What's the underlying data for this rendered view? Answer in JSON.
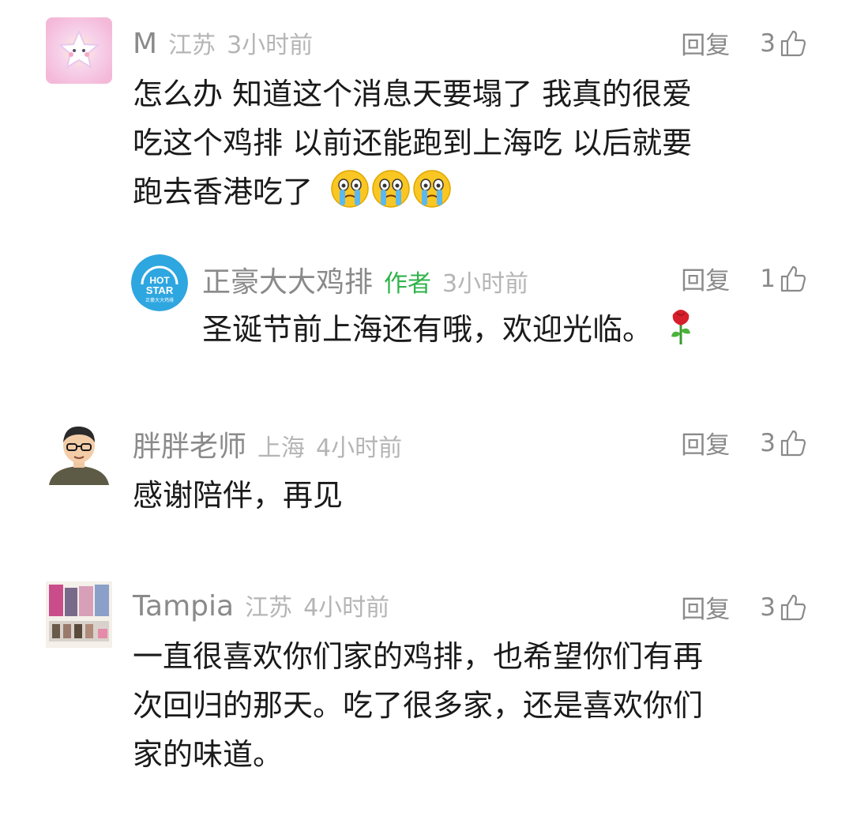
{
  "comments": [
    {
      "name": "M",
      "location": "江苏",
      "time": "3小时前",
      "reply_label": "回复",
      "likes": "3",
      "lines": [
        "怎么办 知道这个消息天要塌了 我真的很爱",
        "吃这个鸡排 以前还能跑到上海吃 以后就要",
        "跑去香港吃了"
      ],
      "emojis": [
        "crying-emoji",
        "crying-emoji",
        "crying-emoji"
      ],
      "reply": {
        "name": "正豪大大鸡排",
        "author_tag": "作者",
        "time": "3小时前",
        "reply_label": "回复",
        "likes": "1",
        "text": "圣诞节前上海还有哦，欢迎光临。",
        "emoji": "rose-emoji",
        "avatar_text": "正豪大大鸡排"
      }
    },
    {
      "name": "胖胖老师",
      "location": "上海",
      "time": "4小时前",
      "reply_label": "回复",
      "likes": "3",
      "lines": [
        "感谢陪伴，再见"
      ]
    },
    {
      "name": "Tampia",
      "location": "江苏",
      "time": "4小时前",
      "reply_label": "回复",
      "likes": "3",
      "lines": [
        "一直很喜欢你们家的鸡排，也希望你们有再",
        "次回归的那天。吃了很多家，还是喜欢你们",
        "家的味道。"
      ]
    }
  ],
  "colors": {
    "name": "#8a8a8a",
    "meta": "#b5b5b5",
    "author_tag": "#2fb34a",
    "text": "#1a1a1a",
    "reply_avatar": "#2ea6e0"
  }
}
